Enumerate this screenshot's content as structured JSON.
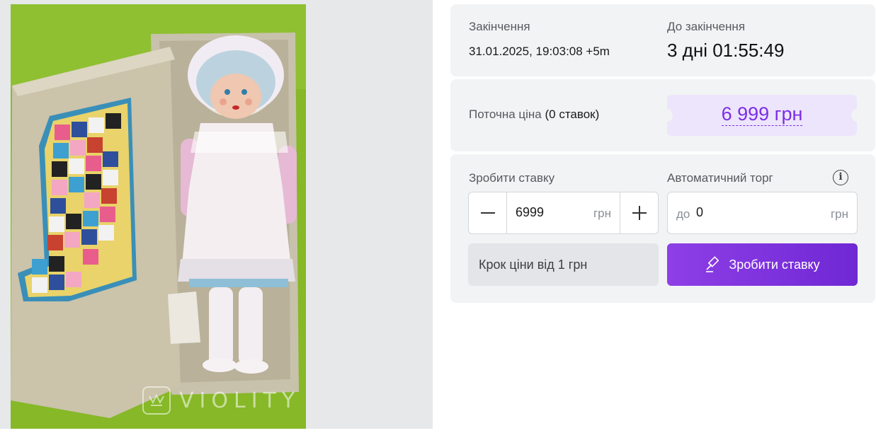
{
  "gallery": {
    "watermark_text": "VIOLITY",
    "photo_alt": "doll-in-box-photo"
  },
  "timer": {
    "end_label": "Закінчення",
    "end_value": "31.01.2025, 19:03:08 +5m",
    "left_label": "До закінчення",
    "left_value": "3 дні 01:55:49"
  },
  "price": {
    "label": "Поточна ціна",
    "bids_count": "(0 ставок)",
    "value": "6 999 грн"
  },
  "bid": {
    "bid_label": "Зробити ставку",
    "auto_label": "Автоматичний торг",
    "info_icon": "i",
    "minus": "—",
    "plus": "+",
    "amount": "6999",
    "currency": "грн",
    "auto_prefix": "до",
    "auto_value": "0",
    "auto_currency": "грн",
    "step_text": "Крок ціни від 1 грн",
    "button_label": "Зробити ставку"
  },
  "colors": {
    "accent": "#7a2ee8",
    "button_start": "#8e3fe6",
    "button_end": "#6f28d4",
    "card_bg": "#f2f3f4",
    "price_bg": "#ede5fb"
  },
  "icons": {
    "info": "info-icon",
    "gavel": "gavel-icon",
    "watermark_logo": "crown-icon"
  }
}
